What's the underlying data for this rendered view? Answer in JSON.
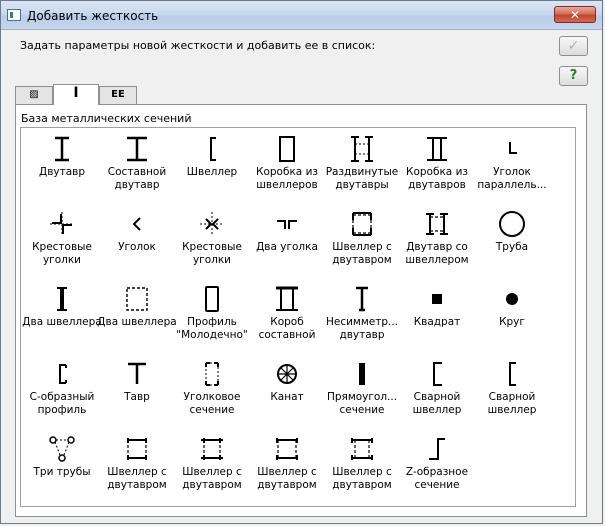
{
  "window": {
    "title": "Добавить жесткость",
    "close_label": "✕"
  },
  "instruction": "Задать параметры новой жесткости и добавить ее в список:",
  "buttons": {
    "ok_icon": "✓",
    "help_icon": "?"
  },
  "tabs": [
    {
      "label": "▨",
      "icon": "hatch-icon"
    },
    {
      "label": "I",
      "icon": "i-beam-icon"
    },
    {
      "label": "EE",
      "icon": "ee-icon"
    }
  ],
  "group_label": "База металлических сечений",
  "sections": [
    {
      "label": "Двутавр",
      "icon": "i-beam"
    },
    {
      "label": "Составной двутавр",
      "icon": "built-up-i-beam"
    },
    {
      "label": "Швеллер",
      "icon": "channel"
    },
    {
      "label": "Коробка из швеллеров",
      "icon": "channel-box"
    },
    {
      "label": "Раздвинутые двутавры",
      "icon": "spread-i-beams"
    },
    {
      "label": "Коробка из двутавров",
      "icon": "i-beam-box"
    },
    {
      "label": "Уголок параллель...",
      "icon": "angle-parallel"
    },
    {
      "label": "Крестовые уголки",
      "icon": "cross-angles"
    },
    {
      "label": "Уголок",
      "icon": "angle"
    },
    {
      "label": "Крестовые уголки",
      "icon": "cross-angles-2"
    },
    {
      "label": "Два уголка",
      "icon": "two-angles"
    },
    {
      "label": "Швеллер с двутавром",
      "icon": "channel-with-i-beam"
    },
    {
      "label": "Двутавр со швеллером",
      "icon": "i-beam-with-channel"
    },
    {
      "label": "Труба",
      "icon": "pipe"
    },
    {
      "label": "Два швеллера",
      "icon": "two-channels"
    },
    {
      "label": "Два швеллера",
      "icon": "two-channels-2"
    },
    {
      "label": "Профиль \"Молодечно\"",
      "icon": "molodechno-profile"
    },
    {
      "label": "Короб составной",
      "icon": "composite-box"
    },
    {
      "label": "Несимметр... двутавр",
      "icon": "asymmetric-i-beam"
    },
    {
      "label": "Квадрат",
      "icon": "square"
    },
    {
      "label": "Круг",
      "icon": "circle"
    },
    {
      "label": "С-образный профиль",
      "icon": "c-profile"
    },
    {
      "label": "Тавр",
      "icon": "tee"
    },
    {
      "label": "Уголковое сечение",
      "icon": "angle-section"
    },
    {
      "label": "Канат",
      "icon": "rope"
    },
    {
      "label": "Прямоугол... сечение",
      "icon": "rectangle"
    },
    {
      "label": "Сварной швеллер",
      "icon": "welded-channel"
    },
    {
      "label": "Сварной швеллер",
      "icon": "welded-channel-2"
    },
    {
      "label": "Три трубы",
      "icon": "three-pipes"
    },
    {
      "label": "Швеллер с двутавром",
      "icon": "channel-with-i-beam-2"
    },
    {
      "label": "Швеллер с двутавром",
      "icon": "channel-with-i-beam-3"
    },
    {
      "label": "Швеллер с двутавром",
      "icon": "channel-with-i-beam-4"
    },
    {
      "label": "Швеллер с двутавром",
      "icon": "channel-with-i-beam-5"
    },
    {
      "label": "Z-образное сечение",
      "icon": "z-section"
    }
  ]
}
